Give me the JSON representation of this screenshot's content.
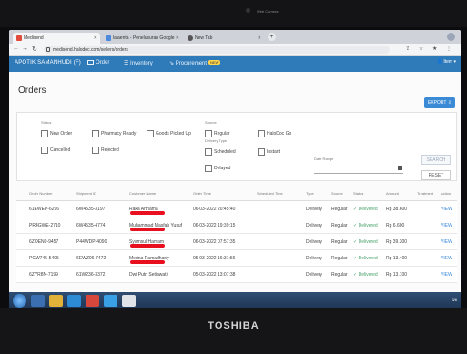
{
  "device": {
    "brand": "TOSHIBA",
    "webcam_label": "Web Camera"
  },
  "browser": {
    "tabs": [
      {
        "label": "Medisend",
        "favicon": "medisend-icon"
      },
      {
        "label": "lalaenta - Penelusuran Google",
        "favicon": "google-icon"
      },
      {
        "label": "New Tab",
        "favicon": "newtab-icon"
      }
    ],
    "url": "medisend.halodoc.com/sellers/orders"
  },
  "app": {
    "name": "APOTIK SAMANHUDI (F)",
    "nav": [
      {
        "label": "Order"
      },
      {
        "label": "Inventory"
      },
      {
        "label": "Procurement",
        "badge": "NEW"
      }
    ],
    "user_button": "Item"
  },
  "page": {
    "title": "Orders",
    "export_label": "EXPORT"
  },
  "filters": {
    "status_label": "Status",
    "status_options": [
      {
        "label": "New Order",
        "checked": false
      },
      {
        "label": "Pharmacy Ready",
        "checked": false
      },
      {
        "label": "Goods Picked Up",
        "checked": false
      },
      {
        "label": "Cancelled",
        "checked": false
      },
      {
        "label": "Rejected",
        "checked": false
      }
    ],
    "source_label": "Source",
    "source_options": [
      {
        "label": "Regular",
        "checked": false
      },
      {
        "label": "HaloDoc Go",
        "checked": false
      }
    ],
    "delivery_label": "Delivery Type",
    "delivery_options": [
      {
        "label": "Scheduled",
        "checked": false
      },
      {
        "label": "Instant",
        "checked": false
      },
      {
        "label": "Delayed",
        "checked": false
      }
    ],
    "date_range_label": "Date Range",
    "search_label": "SEARCH",
    "reset_label": "RESET"
  },
  "table": {
    "columns": [
      "Order Number",
      "Shipment ID",
      "Customer Name",
      "Order Time",
      "Scheduled Time",
      "Type",
      "Source",
      "Status",
      "Amount",
      "Treatment",
      "Action"
    ],
    "rows": [
      {
        "order": "61EWEP-6296",
        "shipment": "6W4535-3197",
        "customer": "Raka Arthama",
        "time": "06-03-2022 20:45:40",
        "type": "Delivery",
        "source": "Regular",
        "status": "Delivered",
        "amount": "Rp 38.600",
        "action": "VIEW"
      },
      {
        "order": "PR4GWE-2710",
        "shipment": "6W4535-4774",
        "customer": "Muhammad Masfah Yusuf",
        "time": "06-03-2022 19:39:15",
        "type": "Delivery",
        "source": "Regular",
        "status": "Delivered",
        "amount": "Rp 6.600",
        "action": "VIEW"
      },
      {
        "order": "6ZOEN0-9457",
        "shipment": "P44WDP-4090",
        "customer": "Syamsul Hamam",
        "time": "06-03-2022 07:57:35",
        "type": "Delivery",
        "source": "Regular",
        "status": "Delivered",
        "amount": "Rp 39.300",
        "action": "VIEW"
      },
      {
        "order": "PCW745-5495",
        "shipment": "6EWZ06-7472",
        "customer": "Merina Ramadhany",
        "time": "05-03-2022 16:31:56",
        "type": "Delivery",
        "source": "Regular",
        "status": "Delivered",
        "amount": "Rp 13.400",
        "action": "VIEW"
      },
      {
        "order": "6ZYR8N-7199",
        "shipment": "61W236-3372",
        "customer": "Dwi Putri Setiawati",
        "time": "05-03-2022 13:07:38",
        "type": "Delivery",
        "source": "Regular",
        "status": "Delivered",
        "amount": "Rp 13.100",
        "action": "VIEW"
      }
    ]
  },
  "taskbar": {
    "tray_text": "3/6"
  },
  "colors": {
    "accent": "#2f7ab9",
    "button": "#3b8ad6",
    "status_ok": "#4aa36b",
    "redaction": "#e8101e"
  }
}
